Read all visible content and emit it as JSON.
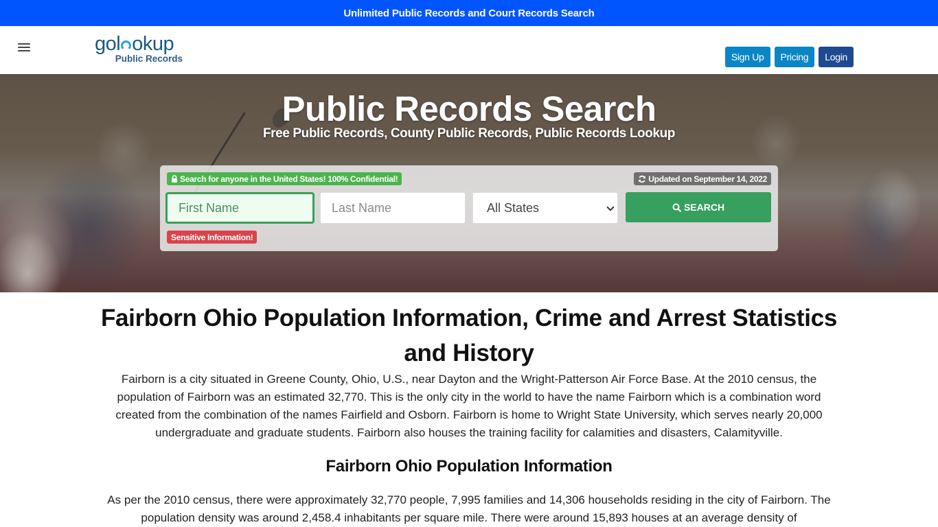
{
  "topbar": {
    "text": "Unlimited Public Records and Court Records Search",
    "background": "#0155ff"
  },
  "navbar": {
    "menu_icon": "hamburger-menu-icon",
    "logo": {
      "main_before": "gol",
      "main_after": "okup",
      "sub": "Public Records"
    },
    "buttons": [
      {
        "label": "Sign Up",
        "color": "#0a86c6"
      },
      {
        "label": "Pricing",
        "color": "#0a86c6"
      },
      {
        "label": "Login",
        "color": "#1e4a92"
      }
    ]
  },
  "hero": {
    "title": "Public Records Search",
    "subtitle": "Free Public Records, County Public Records, Public Records Lookup"
  },
  "search": {
    "confidential_badge": "Search for anyone in the United States! 100% Confidential!",
    "confidential_icon": "lock-icon",
    "updated_badge": "Updated on September 14, 2022",
    "updated_icon": "refresh-icon",
    "first_name_placeholder": "First Name",
    "last_name_placeholder": "Last Name",
    "state_selected": "All States",
    "search_button": "SEARCH",
    "search_icon": "search-icon",
    "sensitive_badge": "Sensitive Information!",
    "colors": {
      "search_button": "#37a05e",
      "confidential_badge": "#4cb44e",
      "sensitive_badge": "#d9434a",
      "updated_badge": "#6f6f6f"
    }
  },
  "content": {
    "title": "Fairborn Ohio Population Information, Crime and Arrest Statistics and History",
    "intro": "Fairborn is a city situated in Greene County, Ohio, U.S., near Dayton and the Wright-Patterson Air Force Base. At the 2010 census, the population of Fairborn was an estimated 32,770. This is the only city in the world to have the name Fairborn which is a combination word created from the combination of the names Fairfield and Osborn. Fairborn is home to Wright State University, which serves nearly 20,000 undergraduate and graduate students. Fairborn also houses the training facility for calamities and disasters, Calamityville.",
    "section_title": "Fairborn Ohio Population Information",
    "section_para": "As per the 2010 census, there were approximately 32,770 people, 7,995 families and 14,306 households residing in the city of Fairborn. The population density was around 2,458.4 inhabitants per square mile. There were around 15,893 houses at an average density of"
  }
}
